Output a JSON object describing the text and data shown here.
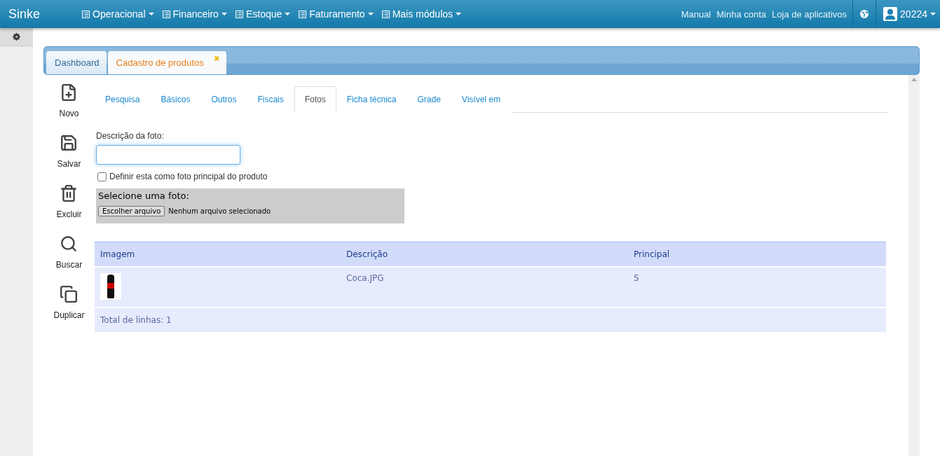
{
  "navbar": {
    "brand": "Sinke",
    "menus": [
      {
        "label": "Operacional"
      },
      {
        "label": "Financeiro"
      },
      {
        "label": "Estoque"
      },
      {
        "label": "Faturamento"
      },
      {
        "label": "Mais módulos"
      }
    ],
    "links": [
      "Manual",
      "Minha conta",
      "Loja de aplicativos"
    ],
    "user": "20224"
  },
  "page_tabs": [
    {
      "label": "Dashboard",
      "selected": false
    },
    {
      "label": "Cadastro de produtos",
      "selected": true,
      "close_glyph": "✖"
    }
  ],
  "toolbar": [
    {
      "kind": "new",
      "label": "Novo"
    },
    {
      "kind": "save",
      "label": "Salvar"
    },
    {
      "kind": "delete",
      "label": "Excluir"
    },
    {
      "kind": "search",
      "label": "Buscar"
    },
    {
      "kind": "duplicate",
      "label": "Duplicar"
    }
  ],
  "form_tabs": [
    {
      "label": "Pesquisa",
      "selected": false
    },
    {
      "label": "Básicos",
      "selected": false
    },
    {
      "label": "Outros",
      "selected": false
    },
    {
      "label": "Fiscais",
      "selected": false
    },
    {
      "label": "Fotos",
      "selected": true
    },
    {
      "label": "Ficha técnica",
      "selected": false
    },
    {
      "label": "Grade",
      "selected": false
    },
    {
      "label": "Visível em",
      "selected": false
    }
  ],
  "form": {
    "description_label": "Descrição da foto:",
    "main_photo": {
      "label": "Definir esta como foto principal do produto",
      "checked": false
    },
    "upload": {
      "title": "Selecione uma foto:",
      "button": "Escolher arquivo",
      "status": "Nenhum arquivo selecionado"
    }
  },
  "table": {
    "columns": [
      "Imagem",
      "Descrição",
      "Principal"
    ],
    "rows": [
      {
        "description": "Coca.JPG",
        "principal": "S"
      }
    ],
    "footer": "Total de linhas: 1"
  }
}
